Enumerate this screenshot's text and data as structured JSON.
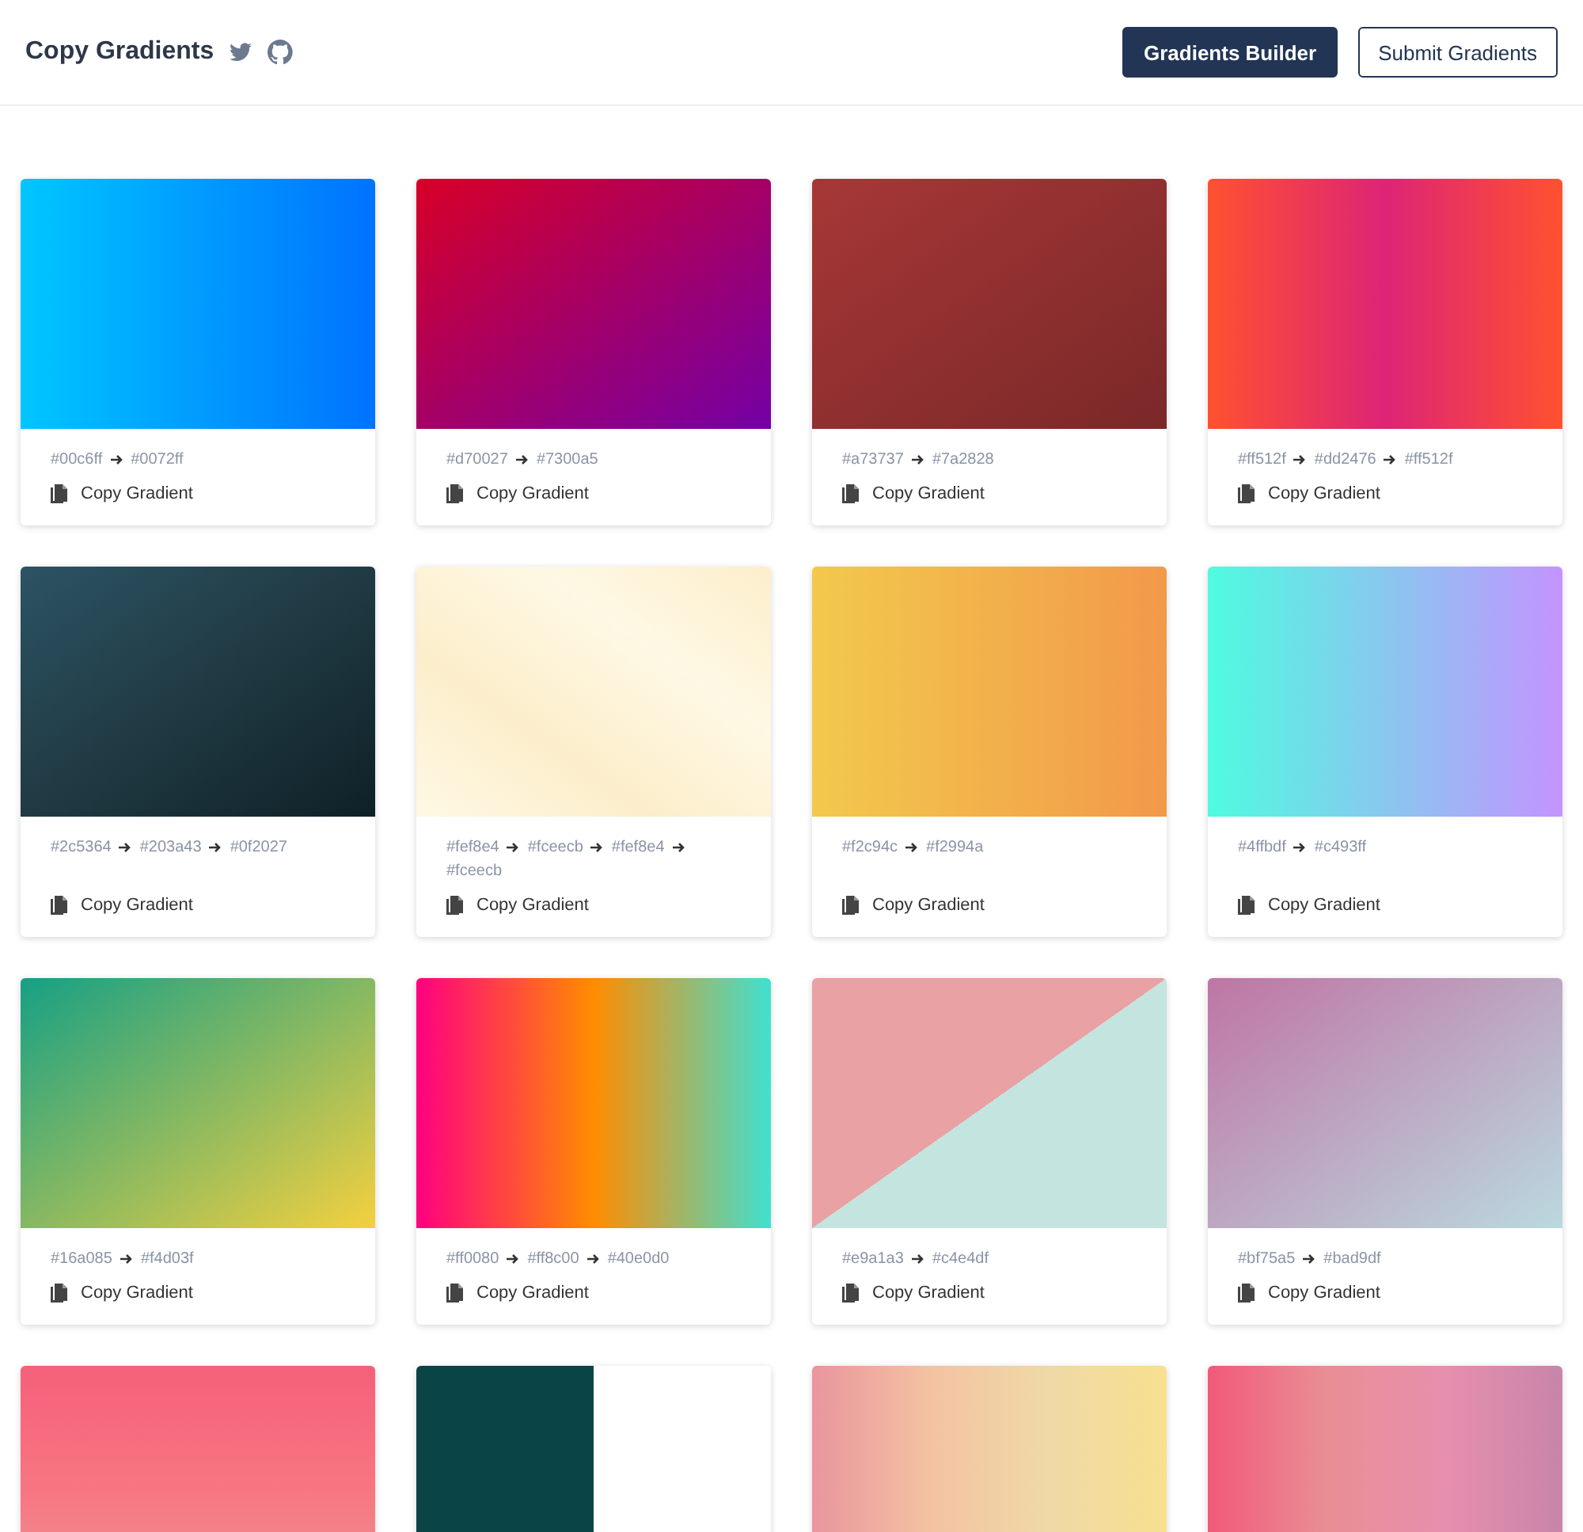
{
  "header": {
    "title": "Copy Gradients",
    "buttons": [
      {
        "label": "Gradients Builder",
        "kind": "primary"
      },
      {
        "label": "Submit Gradients",
        "kind": "outline"
      }
    ]
  },
  "cards": [
    {
      "kind": "horizontal",
      "codes": [
        "#00c6ff",
        "#0072ff"
      ],
      "action": "Copy Gradient"
    },
    {
      "kind": "diagonal",
      "codes": [
        "#d70027",
        "#7300a5"
      ],
      "action": "Copy Gradient"
    },
    {
      "kind": "diagonal",
      "codes": [
        "#a73737",
        "#7a2828"
      ],
      "action": "Copy Gradient"
    },
    {
      "kind": "horizontal",
      "codes": [
        "#ff512f",
        "#dd2476",
        "#ff512f"
      ],
      "action": "Copy Gradient"
    },
    {
      "kind": "diagonal",
      "codes": [
        "#2c5364",
        "#203a43",
        "#0f2027"
      ],
      "action": "Copy Gradient"
    },
    {
      "kind": "diagonal-up",
      "codes": [
        "#fef8e4",
        "#fceecb",
        "#fef8e4",
        "#fceecb"
      ],
      "action": "Copy Gradient"
    },
    {
      "kind": "horizontal",
      "codes": [
        "#f2c94c",
        "#f2994a"
      ],
      "action": "Copy Gradient"
    },
    {
      "kind": "horizontal",
      "codes": [
        "#4ffbdf",
        "#c493ff"
      ],
      "action": "Copy Gradient"
    },
    {
      "kind": "diagonal",
      "codes": [
        "#16a085",
        "#f4d03f"
      ],
      "action": "Copy Gradient"
    },
    {
      "kind": "horizontal",
      "codes": [
        "#ff0080",
        "#ff8c00",
        "#40e0d0"
      ],
      "action": "Copy Gradient"
    },
    {
      "kind": "split-diagonal",
      "codes": [
        "#e9a1a3",
        "#c4e4df"
      ],
      "action": "Copy Gradient"
    },
    {
      "kind": "diagonal",
      "codes": [
        "#bf75a5",
        "#bad9df"
      ],
      "action": "Copy Gradient"
    },
    {
      "kind": "coral-fade"
    },
    {
      "kind": "teal-split"
    },
    {
      "kind": "peach-stripes"
    },
    {
      "kind": "rose-stripes"
    }
  ]
}
